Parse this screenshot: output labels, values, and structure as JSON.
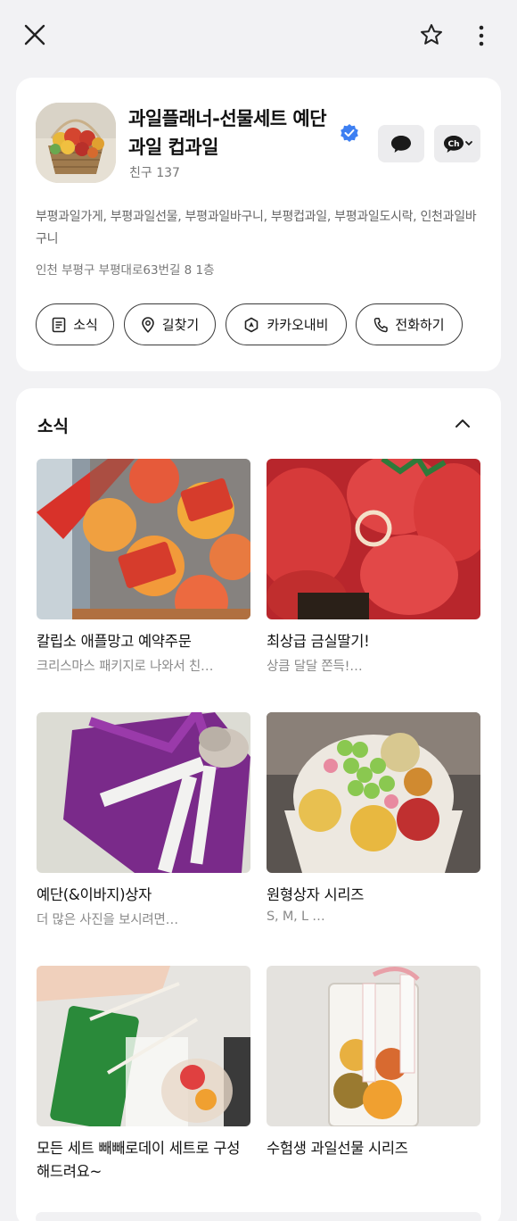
{
  "topbar": {
    "close_icon": "close-icon",
    "favorite_icon": "star-icon",
    "more_icon": "more-vertical-icon"
  },
  "profile": {
    "name": "과일플래너-선물세트 예단과일 컵과일",
    "friends": "친구 137",
    "tags": "부평과일가게, 부평과일선물, 부평과일바구니, 부평컵과일, 부평과일도시락, 인천과일바구니",
    "address": "인천 부평구 부평대로63번길 8 1층",
    "verified_color": "#3d7ff2",
    "actions": [
      {
        "label": "소식",
        "icon": "news-icon"
      },
      {
        "label": "길찾기",
        "icon": "location-pin-icon"
      },
      {
        "label": "카카오내비",
        "icon": "navi-icon"
      },
      {
        "label": "전화하기",
        "icon": "phone-icon"
      }
    ]
  },
  "news": {
    "title": "소식",
    "posts": [
      {
        "title": "칼립소 애플망고 예약주문",
        "desc": "크리스마스 패키지로 나와서 친…"
      },
      {
        "title": "최상급 금실딸기!",
        "desc": "상큼 달달 쫀득!…"
      },
      {
        "title": "예단(&이바지)상자",
        "desc": "더 많은 사진을 보시려면…"
      },
      {
        "title": "원형상자 시리즈",
        "desc": "S, M, L …"
      },
      {
        "title": "모든 세트 빼빼로데이 세트로 구성해드려요~",
        "desc": ""
      },
      {
        "title": "수험생 과일선물 시리즈",
        "desc": ""
      }
    ]
  }
}
